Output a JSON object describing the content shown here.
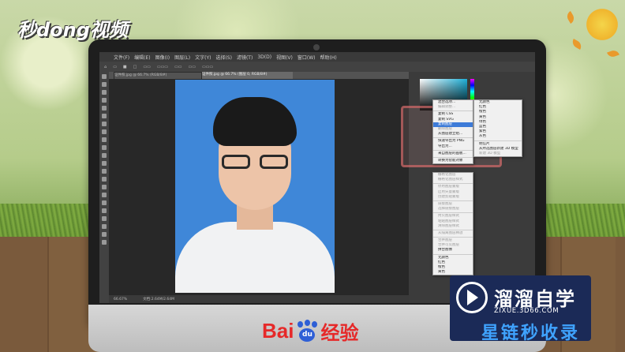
{
  "watermark_top": "秒dong视频",
  "photoshop": {
    "menu": [
      "文件(F)",
      "编辑(E)",
      "图像(I)",
      "图层(L)",
      "文字(Y)",
      "选择(S)",
      "滤镜(T)",
      "3D(D)",
      "视图(V)",
      "窗口(W)",
      "帮助(H)"
    ],
    "doc_tab_1": "证件照.jpg @ 66.7% (RGB/8#)",
    "doc_tab_2": "证件照.jpg @ 66.7% (图层 0, RGB/8#)",
    "status": [
      "66.67%",
      "文档:2.64M/2.64M"
    ],
    "context_menu_left": [
      {
        "label": "混合选项...",
        "state": "normal"
      },
      {
        "label": "编辑调整...",
        "state": "disabled"
      },
      {
        "label": "",
        "state": "sep"
      },
      {
        "label": "复制 CSS",
        "state": "normal"
      },
      {
        "label": "复制 SVG",
        "state": "normal"
      },
      {
        "label": "复制图层",
        "state": "highlight"
      },
      {
        "label": "删除图层",
        "state": "disabled"
      },
      {
        "label": "从图层建立组...",
        "state": "normal"
      },
      {
        "label": "",
        "state": "sep"
      },
      {
        "label": "快速导出为 PNG",
        "state": "normal"
      },
      {
        "label": "导出为...",
        "state": "normal"
      },
      {
        "label": "",
        "state": "sep"
      },
      {
        "label": "来自图层的画板...",
        "state": "normal"
      },
      {
        "label": "",
        "state": "sep"
      },
      {
        "label": "转换为智能对象",
        "state": "normal"
      }
    ],
    "context_menu_right": [
      {
        "label": "无颜色",
        "state": "normal"
      },
      {
        "label": "红色",
        "state": "normal"
      },
      {
        "label": "橙色",
        "state": "normal"
      },
      {
        "label": "黄色",
        "state": "normal"
      },
      {
        "label": "绿色",
        "state": "normal"
      },
      {
        "label": "蓝色",
        "state": "normal"
      },
      {
        "label": "紫色",
        "state": "normal"
      },
      {
        "label": "灰色",
        "state": "normal"
      },
      {
        "label": "",
        "state": "sep"
      },
      {
        "label": "明信片",
        "state": "normal"
      },
      {
        "label": "从所选图层新建 3D 模型",
        "state": "normal"
      },
      {
        "label": "新建 3D 模型",
        "state": "disabled"
      }
    ],
    "context_menu_lower": [
      {
        "label": "栅格化图层",
        "state": "disabled"
      },
      {
        "label": "栅格化图层样式",
        "state": "disabled"
      },
      {
        "label": "",
        "state": "sep"
      },
      {
        "label": "停用图层蒙版",
        "state": "disabled"
      },
      {
        "label": "启用矢量蒙版",
        "state": "disabled"
      },
      {
        "label": "创建剪贴蒙版",
        "state": "disabled"
      },
      {
        "label": "",
        "state": "sep"
      },
      {
        "label": "链接图层",
        "state": "disabled"
      },
      {
        "label": "选择链接图层",
        "state": "disabled"
      },
      {
        "label": "",
        "state": "sep"
      },
      {
        "label": "拷贝图层样式",
        "state": "disabled"
      },
      {
        "label": "粘贴图层样式",
        "state": "disabled"
      },
      {
        "label": "清除图层样式",
        "state": "disabled"
      },
      {
        "label": "",
        "state": "sep"
      },
      {
        "label": "从隔离图层释放",
        "state": "disabled"
      },
      {
        "label": "",
        "state": "sep"
      },
      {
        "label": "合并图层",
        "state": "disabled"
      },
      {
        "label": "合并可见图层",
        "state": "disabled"
      },
      {
        "label": "拼合图像",
        "state": "normal"
      },
      {
        "label": "",
        "state": "sep"
      },
      {
        "label": "无颜色",
        "state": "normal"
      },
      {
        "label": "红色",
        "state": "normal"
      },
      {
        "label": "橙色",
        "state": "normal"
      },
      {
        "label": "黄色",
        "state": "normal"
      }
    ]
  },
  "baidu": {
    "bai": "Bai",
    "du": "du",
    "jingyan": "经验"
  },
  "zixue": {
    "title": "溜溜自学",
    "url": "ZIXUE.3D66.COM",
    "sub": "星链秒收录"
  },
  "colors": {
    "photo_bg": "#3f87d8",
    "highlight": "#3d7bd8",
    "baidu_red": "#e62929",
    "baidu_blue": "#2e5fd6"
  }
}
